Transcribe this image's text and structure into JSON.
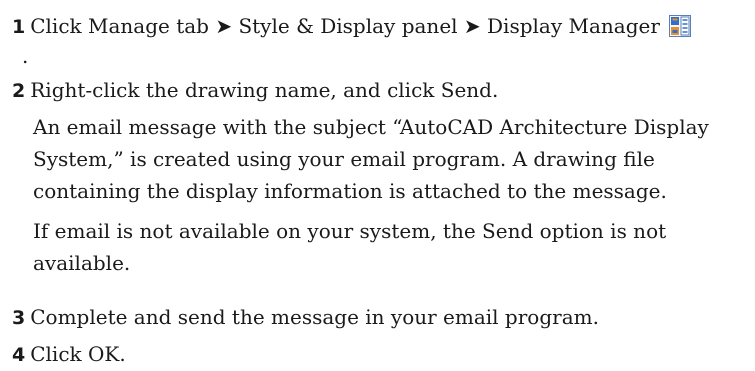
{
  "steps": [
    {
      "number": "1",
      "text": "Click Manage tab ➤ Style & Display panel ➤ Display Manager",
      "trailing": ".",
      "icon": "display-manager-icon"
    },
    {
      "number": "2",
      "text": "Right-click the drawing name, and click Send."
    },
    {
      "number": "3",
      "text": "Complete and send the message in your email program."
    },
    {
      "number": "4",
      "text": "Click OK."
    }
  ],
  "paragraphs": {
    "email_line1": "An email message with the subject “AutoCAD Architecture Display",
    "email_line2": "System,” is created using your email program. A drawing file",
    "email_line3": "containing the display information is attached to the message.",
    "avail_line1": "If email is not available on your system, the Send option is not",
    "avail_line2": "available."
  },
  "colors": {
    "icon_blue": "#2f6fd0",
    "icon_orange": "#e8902a",
    "icon_frame": "#5a7fb8"
  }
}
